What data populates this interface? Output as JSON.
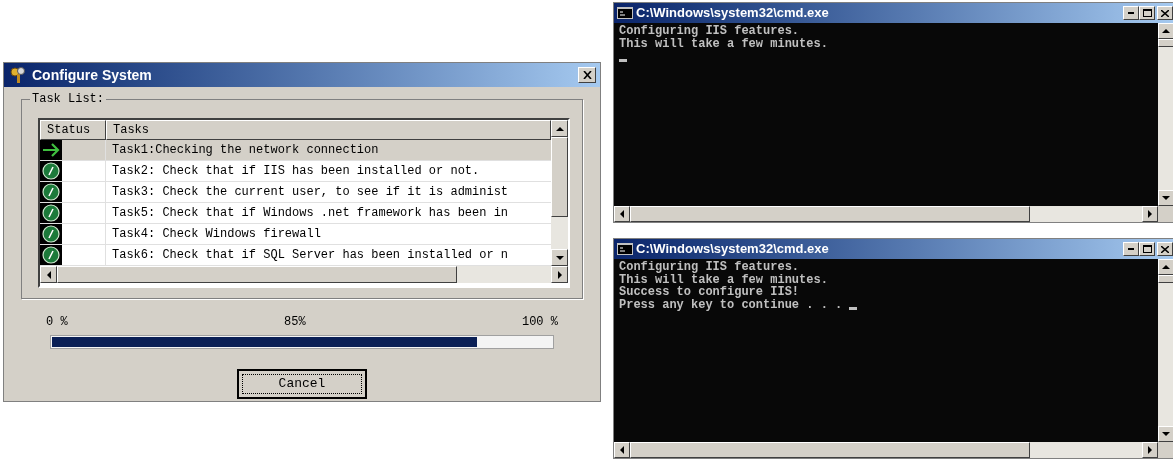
{
  "dialog": {
    "title": "Configure System",
    "group_label": "Task List:",
    "columns": [
      "Status",
      "Tasks"
    ],
    "tasks": [
      {
        "kind": "running",
        "label": "Task1:Checking the network connection",
        "selected": true
      },
      {
        "kind": "done",
        "label": "Task2: Check that if IIS has been installed or not.",
        "selected": false
      },
      {
        "kind": "done",
        "label": "Task3: Check the current user, to see if it is administ",
        "selected": false
      },
      {
        "kind": "done",
        "label": "Task5: Check that if Windows .net framework has been in",
        "selected": false
      },
      {
        "kind": "done",
        "label": "Task4: Check Windows firewall",
        "selected": false
      },
      {
        "kind": "done",
        "label": "Task6: Check that if SQL Server has been installed or n",
        "selected": false
      }
    ],
    "progress": {
      "min_label": "0 %",
      "value_label": "85%",
      "max_label": "100 %",
      "level": 0.85
    },
    "cancel_button": "Cancel"
  },
  "consoles": [
    {
      "title": "C:\\Windows\\system32\\cmd.exe",
      "lines": [
        "Configuring IIS features.",
        "This will take a few minutes."
      ],
      "cursor_on_new_line": true
    },
    {
      "title": "C:\\Windows\\system32\\cmd.exe",
      "lines": [
        "Configuring IIS features.",
        "This will take a few minutes.",
        "Success to configure IIS!",
        "Press any key to continue . . ."
      ],
      "cursor_on_new_line": false
    }
  ]
}
